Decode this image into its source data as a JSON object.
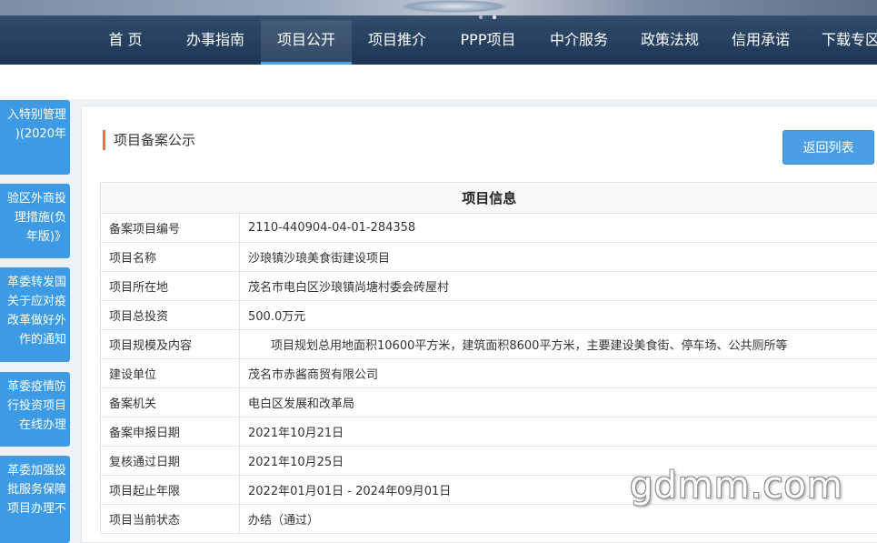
{
  "nav": {
    "items": [
      "首 页",
      "办事指南",
      "项目公开",
      "项目推介",
      "PPP项目",
      "中介服务",
      "政策法规",
      "信用承诺",
      "下载专区"
    ],
    "active_index": 2
  },
  "sidebar": {
    "items": [
      {
        "lines": [
          "入特别管理",
          ")(2020年",
          ""
        ]
      },
      {
        "lines": [
          "验区外商投",
          "理措施(负",
          "年版)》"
        ]
      },
      {
        "lines": [
          "革委转发国",
          "关于应对疫",
          "改革做好外",
          "作的通知"
        ]
      },
      {
        "lines": [
          "革委疫情防",
          "行投资项目",
          "在线办理"
        ]
      },
      {
        "lines": [
          "革委加强投",
          "批服务保障",
          "项目办理不"
        ]
      }
    ]
  },
  "panel": {
    "title": "项目备案公示",
    "back_button": "返回列表"
  },
  "table": {
    "header": "项目信息",
    "rows": [
      {
        "key": "备案项目编号",
        "value": "2110-440904-04-01-284358"
      },
      {
        "key": "项目名称",
        "value": "沙琅镇沙琅美食街建设项目"
      },
      {
        "key": "项目所在地",
        "value": "茂名市电白区沙琅镇尚塘村委会砖屋村"
      },
      {
        "key": "项目总投资",
        "value": "500.0万元"
      },
      {
        "key": "项目规模及内容",
        "value": "项目规划总用地面积10600平方米，建筑面积8600平方米，主要建设美食街、停车场、公共厕所等"
      },
      {
        "key": "建设单位",
        "value": "茂名市赤酱商贸有限公司"
      },
      {
        "key": "备案机关",
        "value": "电白区发展和改革局"
      },
      {
        "key": "备案申报日期",
        "value": "2021年10月21日"
      },
      {
        "key": "复核通过日期",
        "value": "2021年10月25日"
      },
      {
        "key": "项目起止年限",
        "value": "2022年01月01日 - 2024年09月01日"
      },
      {
        "key": "项目当前状态",
        "value": "办结（通过）"
      }
    ]
  },
  "watermark": "gdmm.com",
  "colors": {
    "accent": "#4a9ee3",
    "title_bar": "#e8734a",
    "nav_bg": "#1d3657",
    "sidebar": "#3d9be6"
  }
}
